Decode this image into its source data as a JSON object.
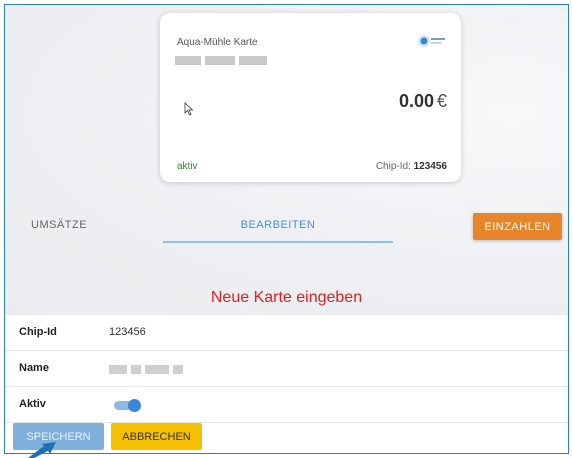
{
  "card": {
    "title": "Aqua-Mühle Karte",
    "amount": "0.00",
    "currency": "€",
    "status": "aktiv",
    "chip_label": "Chip-Id:",
    "chip_value": "123456",
    "logo_icon": "aqua-logo-icon"
  },
  "tabs": {
    "umsaetze": "UMSÄTZE",
    "bearbeiten": "BEARBEITEN"
  },
  "actions": {
    "einzahlen": "EINZAHLEN",
    "speichern": "SPEICHERN",
    "abbrechen": "ABBRECHEN"
  },
  "form": {
    "heading": "Neue Karte eingeben",
    "chip_id_label": "Chip-Id",
    "chip_id_value": "123456",
    "name_label": "Name",
    "aktiv_label": "Aktiv",
    "aktiv_value": true
  },
  "colors": {
    "accent_orange": "#e8852a",
    "accent_blue": "#4a90d9",
    "heading_red": "#e02020",
    "status_green": "#2e8b2e",
    "cancel_yellow": "#f5c000"
  }
}
